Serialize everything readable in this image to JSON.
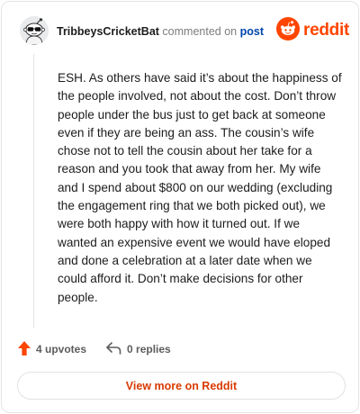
{
  "header": {
    "username": "TribbeysCricketBat",
    "action_text": "commented on",
    "post_link": "post",
    "brand_name": "reddit",
    "avatar_icon": "snoo-avatar-icon",
    "brand_icon": "reddit-logo-icon"
  },
  "comment": {
    "body": "ESH. As others have said it’s about the happiness of the people involved, not about the cost. Don’t throw people under the bus just to get back at someone even if they are being an ass. The cousin’s wife chose not to tell the cousin about her take for a reason and you took that away from her. My wife and I spend about $800 on our wedding (excluding the engagement ring that we both picked out), we were both happy with how it turned out. If we wanted an expensive event we would have eloped and done a celebration at a later date when we could afford it. Don’t make decisions for other people."
  },
  "actions": {
    "upvotes_label": "4 upvotes",
    "replies_label": "0 replies",
    "upvote_icon": "upvote-arrow-icon",
    "reply_icon": "reply-arrow-icon"
  },
  "footer": {
    "view_more_label": "View more on Reddit"
  },
  "colors": {
    "brand_orange": "#ff4500",
    "upvote_orange": "#ff4500",
    "link_blue": "#0045ac",
    "cta_red": "#d93a00"
  }
}
